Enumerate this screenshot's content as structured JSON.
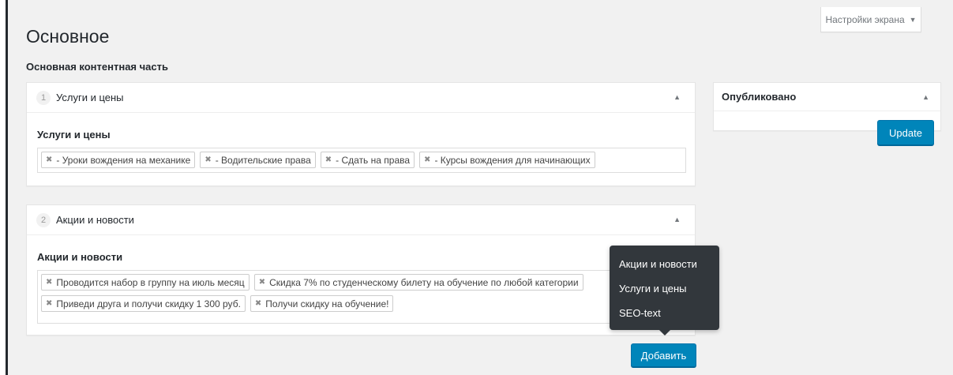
{
  "screen_options": {
    "label": "Настройки экрана"
  },
  "page": {
    "title": "Основное"
  },
  "main": {
    "section_label": "Основная контентная часть",
    "layouts": [
      {
        "order": "1",
        "title": "Услуги и цены",
        "field_label": "Услуги и цены",
        "items": [
          "- Уроки вождения на механике",
          "- Водительские права",
          "- Сдать на права",
          "- Курсы вождения для начинающих"
        ]
      },
      {
        "order": "2",
        "title": "Акции и новости",
        "field_label": "Акции и новости",
        "items": [
          "Проводится набор в группу на июль месяц",
          "Скидка 7% по студенческому билету на обучение по любой категории",
          "Приведи друга и получи скидку 1 300 руб.",
          "Получи скидку на обучение!"
        ]
      }
    ],
    "add_button": "Добавить",
    "popup_menu": [
      "Акции и новости",
      "Услуги и цены",
      "SEO-text"
    ]
  },
  "sidebar": {
    "publish_title": "Опубликовано",
    "update_button": "Update"
  },
  "icons": {
    "remove": "close-icon",
    "toggle": "triangle-up-icon",
    "screen_options_arrow": "triangle-down-icon"
  },
  "colors": {
    "primary": "#0085ba",
    "popup_bg": "#32373c",
    "background": "#f1f1f1"
  }
}
